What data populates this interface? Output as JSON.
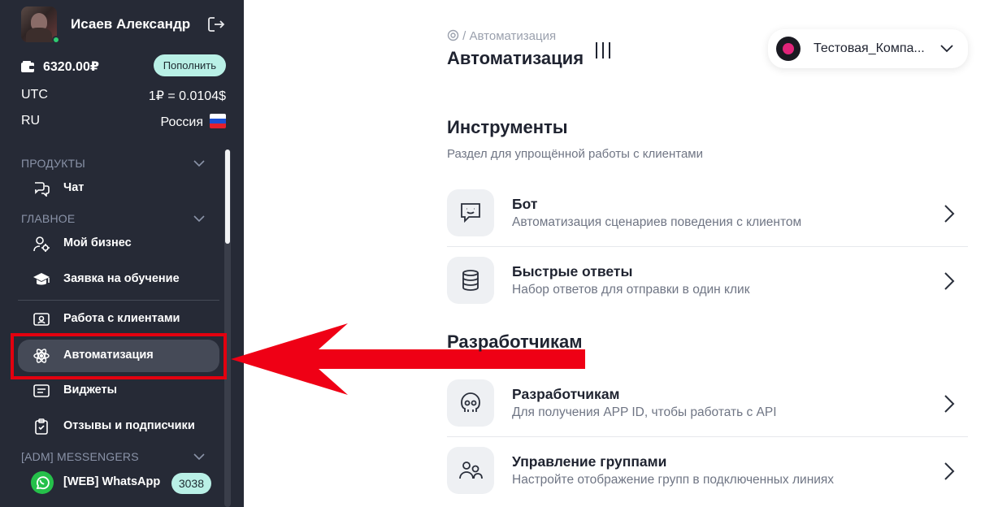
{
  "user": {
    "name": "Исаев Александр"
  },
  "account": {
    "balance": "6320.00₽",
    "topup_label": "Пополнить",
    "timezone_key": "UTC",
    "rate": "1₽ = 0.0104$",
    "lang_key": "RU",
    "country": "Россия"
  },
  "sidebar": {
    "sections": [
      {
        "title": "ПРОДУКТЫ"
      },
      {
        "title": "ГЛАВНОЕ"
      },
      {
        "title": "[ADM] MESSENGERS"
      }
    ],
    "items": [
      {
        "label": "Чат",
        "icon": "chat-icon"
      },
      {
        "label": "Мой бизнес",
        "icon": "business-icon"
      },
      {
        "label": "Заявка на обучение",
        "icon": "graduation-cap-icon"
      },
      {
        "label": "Работа с клиентами",
        "icon": "contact-card-icon"
      },
      {
        "label": "Автоматизация",
        "icon": "automation-atom-icon",
        "active": true
      },
      {
        "label": "Виджеты",
        "icon": "widgets-icon"
      },
      {
        "label": "Отзывы и подписчики",
        "icon": "reviews-clipboard-icon"
      },
      {
        "label": "[WEB] WhatsApp",
        "icon": "whatsapp-icon",
        "count": "3038"
      }
    ]
  },
  "header": {
    "breadcrumb": "/ Автоматизация",
    "title": "Автоматизация",
    "company": "Тестовая_Компа..."
  },
  "tools": {
    "title": "Инструменты",
    "subtitle": "Раздел для упрощённой работы с клиентами",
    "cards": [
      {
        "title": "Бот",
        "desc": "Автоматизация сценариев поведения с клиентом",
        "icon": "bot-chat-icon"
      },
      {
        "title": "Быстрые ответы",
        "desc": "Набор ответов для отправки в один клик",
        "icon": "database-icon"
      }
    ]
  },
  "developers": {
    "title": "Разработчикам",
    "cards": [
      {
        "title": "Разработчикам",
        "desc": "Для получения APP ID, чтобы работать с API",
        "icon": "developer-octocat-icon"
      },
      {
        "title": "Управление группами",
        "desc": "Настройте отображение групп в подключенных линиях",
        "icon": "groups-icon"
      }
    ]
  },
  "colors": {
    "sidebar_bg": "#262a36",
    "active_item": "#454a57",
    "accent_mint": "#b9f0e6",
    "highlight_red": "#e3000f"
  }
}
